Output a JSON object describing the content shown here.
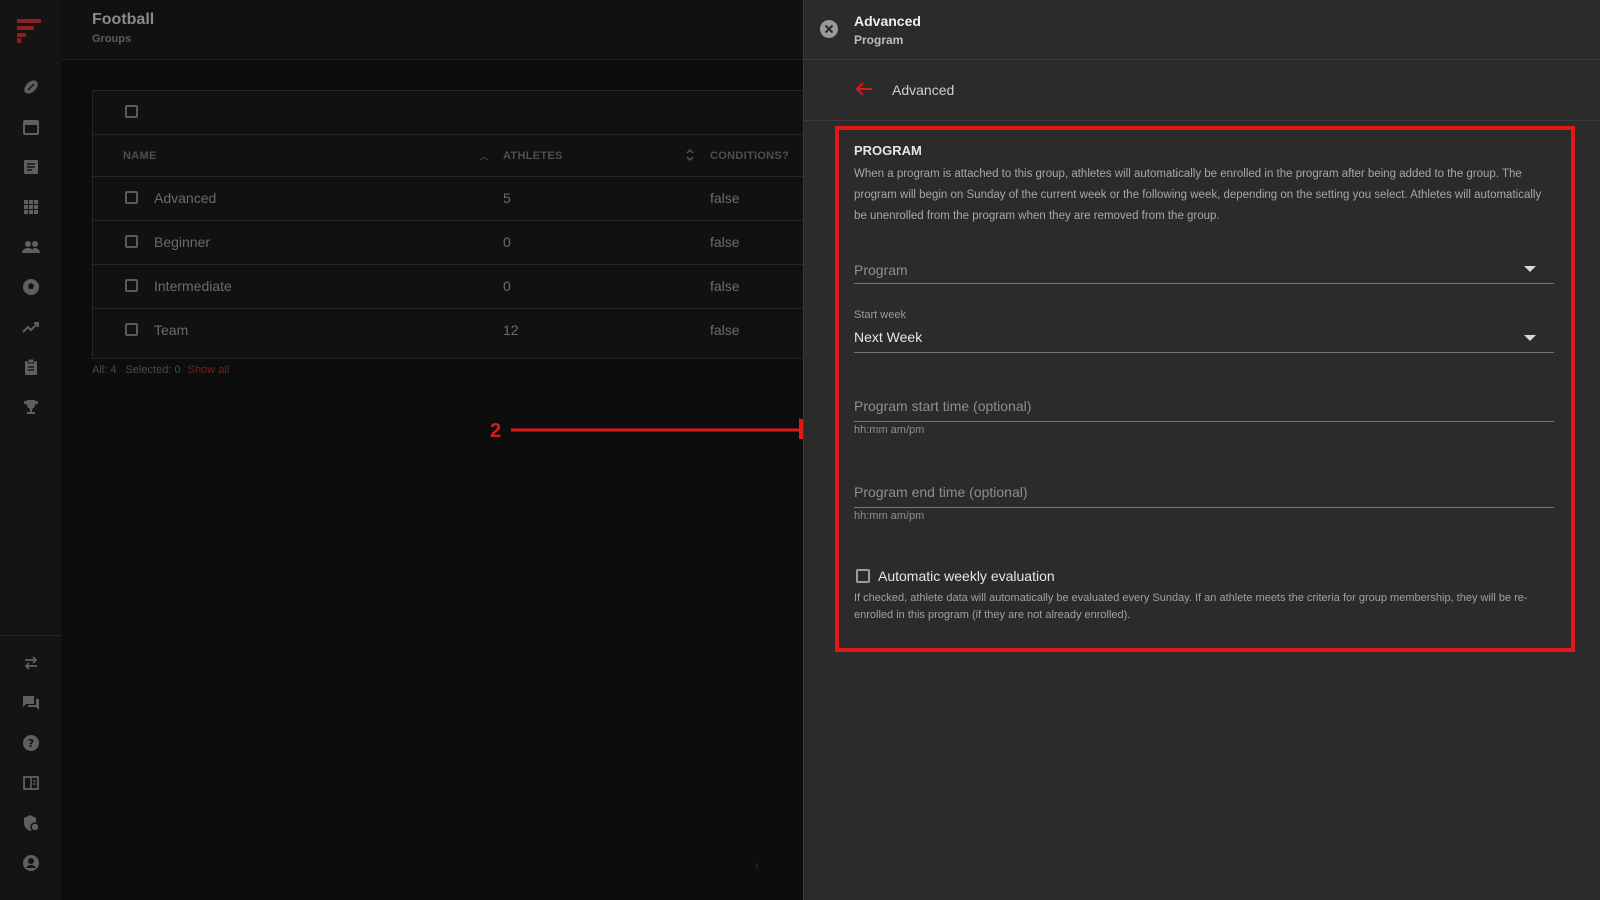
{
  "colors": {
    "accent": "#e01818",
    "drawer_bg": "#2b2b2b",
    "page_bg": "#0b0b0b"
  },
  "app": {
    "title": "Football",
    "subtitle": "Groups"
  },
  "rail": {
    "items": [
      "football-icon",
      "calendar-icon",
      "notes-icon",
      "grid-icon",
      "people-icon",
      "soccer-ball-icon",
      "trending-icon",
      "clipboard-icon",
      "trophy-icon"
    ],
    "bottom_items": [
      "swap-icon",
      "chat-icon",
      "help-icon",
      "guide-icon",
      "security-icon",
      "account-icon"
    ]
  },
  "table": {
    "headers": {
      "name": "NAME",
      "athletes": "ATHLETES",
      "conditions": "CONDITIONS?"
    },
    "rows": [
      {
        "name": "Advanced",
        "athletes": "5",
        "conditions": "false"
      },
      {
        "name": "Beginner",
        "athletes": "0",
        "conditions": "false"
      },
      {
        "name": "Intermediate",
        "athletes": "0",
        "conditions": "false"
      },
      {
        "name": "Team",
        "athletes": "12",
        "conditions": "false"
      }
    ],
    "footer": {
      "all": "All: 4",
      "selected": "Selected: 0",
      "show_all": "Show all"
    }
  },
  "annotation": {
    "number": "2"
  },
  "drawer": {
    "title": "Advanced",
    "subtitle": "Program",
    "back_label": "Advanced",
    "section_title": "PROGRAM",
    "section_desc": "When a program is attached to this group, athletes will automatically be enrolled in the program after being added to the group. The program will begin on Sunday of the current week or the following week, depending on the setting you select. Athletes will automatically be unenrolled from the program when they are removed from the group.",
    "program_placeholder": "Program",
    "start_week_label": "Start week",
    "start_week_value": "Next Week",
    "start_time_placeholder": "Program start time (optional)",
    "start_time_helper": "hh:mm am/pm",
    "end_time_placeholder": "Program end time (optional)",
    "end_time_helper": "hh:mm am/pm",
    "auto_eval_label": "Automatic weekly evaluation",
    "auto_eval_help": "If checked, athlete data will automatically be evaluated every Sunday. If an athlete meets the criteria for group membership, they will be re-enrolled in this program (if they are not already enrolled).",
    "auto_eval_checked": false
  }
}
